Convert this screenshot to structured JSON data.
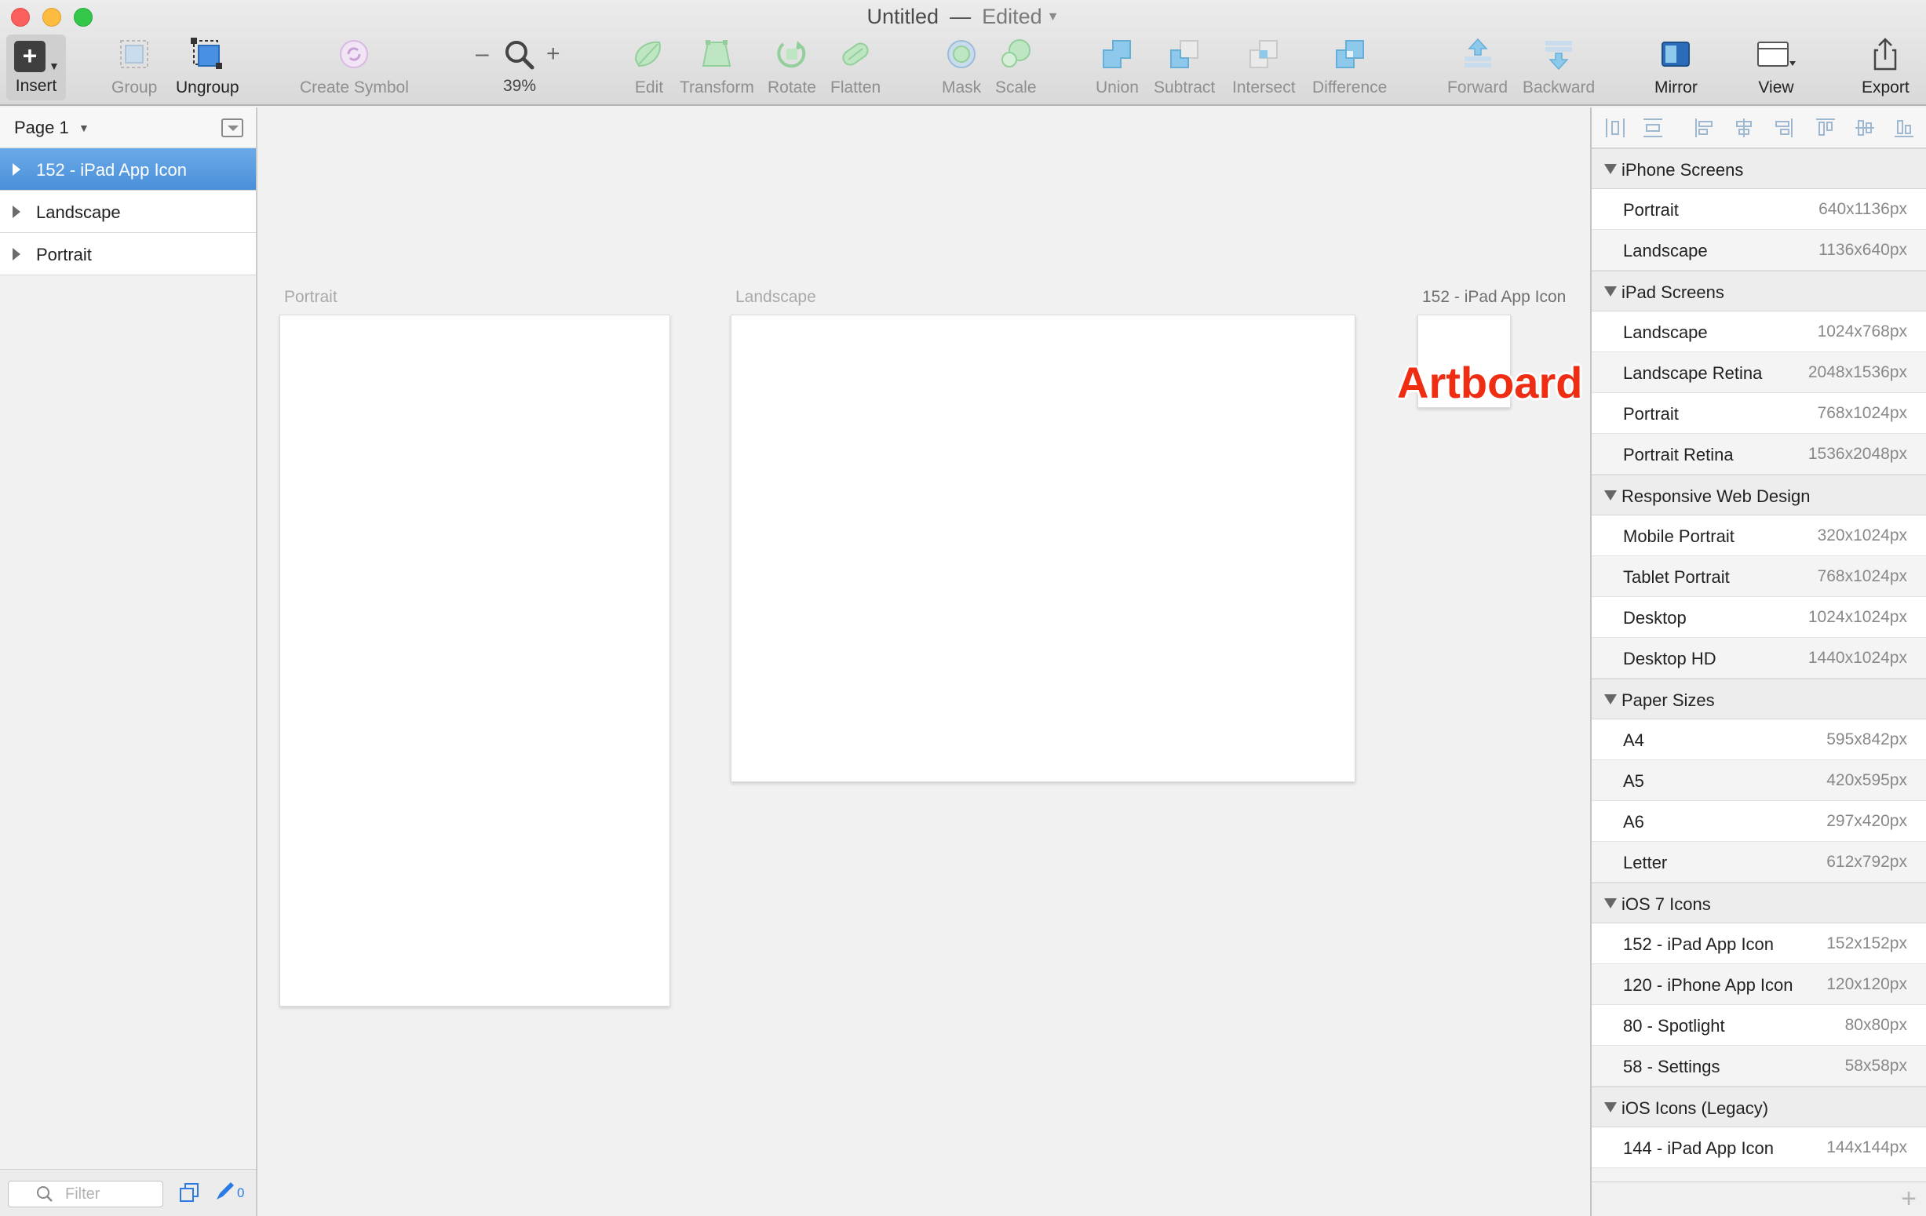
{
  "window": {
    "title": "Untitled",
    "separator": "—",
    "status": "Edited"
  },
  "toolbar": {
    "insert": "Insert",
    "group": "Group",
    "ungroup": "Ungroup",
    "create_symbol": "Create Symbol",
    "zoom_minus": "–",
    "zoom_plus": "+",
    "zoom": "39%",
    "edit": "Edit",
    "transform": "Transform",
    "rotate": "Rotate",
    "flatten": "Flatten",
    "mask": "Mask",
    "scale": "Scale",
    "union": "Union",
    "subtract": "Subtract",
    "intersect": "Intersect",
    "difference": "Difference",
    "forward": "Forward",
    "backward": "Backward",
    "mirror": "Mirror",
    "view": "View",
    "export": "Export"
  },
  "layers": {
    "page": "Page 1",
    "items": [
      {
        "label": "152 - iPad App Icon",
        "selected": true
      },
      {
        "label": "Landscape",
        "selected": false
      },
      {
        "label": "Portrait",
        "selected": false
      }
    ],
    "filter_placeholder": "Filter",
    "edit_count": "0"
  },
  "canvas": {
    "artboards": [
      {
        "label": "Portrait"
      },
      {
        "label": "Landscape"
      },
      {
        "label": "152 - iPad App Icon"
      }
    ],
    "callout": "Artboard"
  },
  "inspector": {
    "groups": [
      {
        "title": "iPhone Screens",
        "presets": [
          {
            "name": "Portrait",
            "size": "640x1136px"
          },
          {
            "name": "Landscape",
            "size": "1136x640px"
          }
        ]
      },
      {
        "title": "iPad Screens",
        "presets": [
          {
            "name": "Landscape",
            "size": "1024x768px"
          },
          {
            "name": "Landscape Retina",
            "size": "2048x1536px"
          },
          {
            "name": "Portrait",
            "size": "768x1024px"
          },
          {
            "name": "Portrait Retina",
            "size": "1536x2048px"
          }
        ]
      },
      {
        "title": "Responsive Web Design",
        "presets": [
          {
            "name": "Mobile Portrait",
            "size": "320x1024px"
          },
          {
            "name": "Tablet Portrait",
            "size": "768x1024px"
          },
          {
            "name": "Desktop",
            "size": "1024x1024px"
          },
          {
            "name": "Desktop HD",
            "size": "1440x1024px"
          }
        ]
      },
      {
        "title": "Paper Sizes",
        "presets": [
          {
            "name": "A4",
            "size": "595x842px"
          },
          {
            "name": "A5",
            "size": "420x595px"
          },
          {
            "name": "A6",
            "size": "297x420px"
          },
          {
            "name": "Letter",
            "size": "612x792px"
          }
        ]
      },
      {
        "title": "iOS 7 Icons",
        "presets": [
          {
            "name": "152 - iPad App Icon",
            "size": "152x152px"
          },
          {
            "name": "120 - iPhone App Icon",
            "size": "120x120px"
          },
          {
            "name": "80 - Spotlight",
            "size": "80x80px"
          },
          {
            "name": "58 - Settings",
            "size": "58x58px"
          }
        ]
      },
      {
        "title": "iOS Icons (Legacy)",
        "presets": [
          {
            "name": "144 - iPad App Icon",
            "size": "144x144px"
          }
        ]
      }
    ],
    "add": "+"
  },
  "colors": {
    "selection": "#4a8fda",
    "callout": "#ee2d12",
    "accent": "#2c7be5"
  }
}
